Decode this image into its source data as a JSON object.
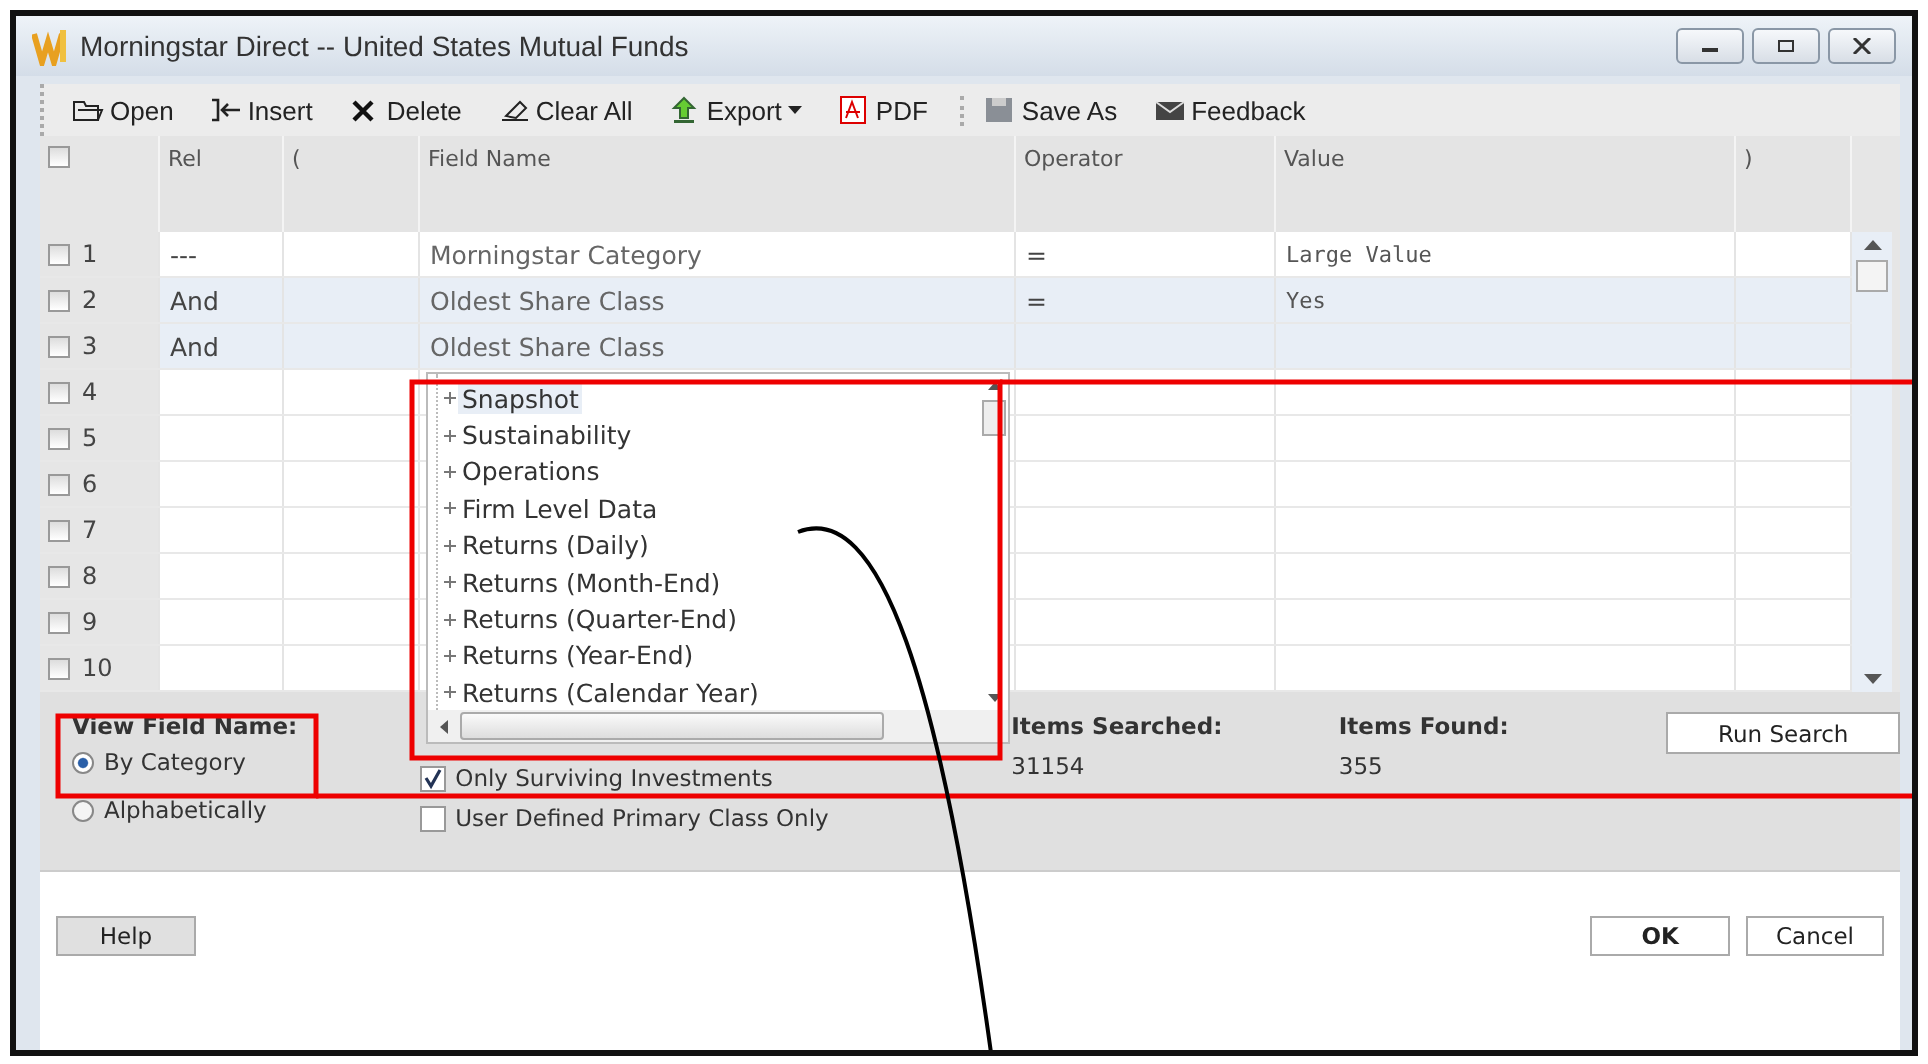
{
  "window": {
    "title": "Morningstar Direct -- United States Mutual Funds"
  },
  "toolbar": [
    {
      "kind": "open",
      "label": "Open",
      "menu": false,
      "separator_before": false
    },
    {
      "kind": "insert",
      "label": "Insert",
      "menu": false,
      "separator_before": false
    },
    {
      "kind": "delete",
      "label": "Delete",
      "menu": false,
      "separator_before": false
    },
    {
      "kind": "clear",
      "label": "Clear All",
      "menu": false,
      "separator_before": false
    },
    {
      "kind": "export",
      "label": "Export",
      "menu": true,
      "separator_before": false
    },
    {
      "kind": "pdf",
      "label": "PDF",
      "menu": false,
      "separator_before": false
    },
    {
      "kind": "save",
      "label": "Save As",
      "menu": false,
      "separator_before": true
    },
    {
      "kind": "feedback",
      "label": "Feedback",
      "menu": false,
      "separator_before": false
    }
  ],
  "table": {
    "header_checked": false,
    "columns": [
      "Rel",
      "(",
      "Field Name",
      "Operator",
      "Value",
      ")"
    ],
    "rows": [
      {
        "number": "1",
        "checked": false,
        "highlighted": false,
        "rel": "---",
        "field_name": "Morningstar Category",
        "operator": "=",
        "value": "Large Value"
      },
      {
        "number": "2",
        "checked": false,
        "highlighted": true,
        "rel": "And",
        "field_name": "Oldest Share Class",
        "operator": "=",
        "value": "Yes"
      },
      {
        "number": "3",
        "checked": false,
        "highlighted": true,
        "rel": "And",
        "field_name": "Oldest Share Class"
      },
      {
        "number": "4",
        "checked": false,
        "highlighted": false
      },
      {
        "number": "5",
        "checked": false,
        "highlighted": false
      },
      {
        "number": "6",
        "checked": false,
        "highlighted": false
      },
      {
        "number": "7",
        "checked": false,
        "highlighted": false
      },
      {
        "number": "8",
        "checked": false,
        "highlighted": false
      },
      {
        "number": "9",
        "checked": false,
        "highlighted": false
      },
      {
        "number": "10",
        "checked": false,
        "highlighted": false
      }
    ]
  },
  "field_dropdown": {
    "items": [
      {
        "label": "Snapshot",
        "selected": true
      },
      {
        "label": "Sustainability",
        "selected": false
      },
      {
        "label": "Operations",
        "selected": false
      },
      {
        "label": "Firm Level Data",
        "selected": false
      },
      {
        "label": "Returns (Daily)",
        "selected": false
      },
      {
        "label": "Returns (Month-End)",
        "selected": false
      },
      {
        "label": "Returns (Quarter-End)",
        "selected": false
      },
      {
        "label": "Returns (Year-End)",
        "selected": false
      },
      {
        "label": "Returns (Calendar Year)",
        "selected": false
      }
    ]
  },
  "options": {
    "view_field_name": "View Field Name:",
    "radios": [
      {
        "label": "By Category",
        "selected": true
      },
      {
        "label": "Alphabetically",
        "selected": false
      }
    ],
    "checkboxes": [
      {
        "label": "Only Surviving Investments",
        "checked": true
      },
      {
        "label": "User Defined Primary Class Only",
        "checked": false
      }
    ],
    "items_searched": {
      "label": "Items Searched:",
      "value": "31154"
    },
    "items_found": {
      "label": "Items Found:",
      "value": "355"
    },
    "run_search": "Run Search"
  },
  "buttons": {
    "help": "Help",
    "ok": "OK",
    "cancel": "Cancel"
  }
}
